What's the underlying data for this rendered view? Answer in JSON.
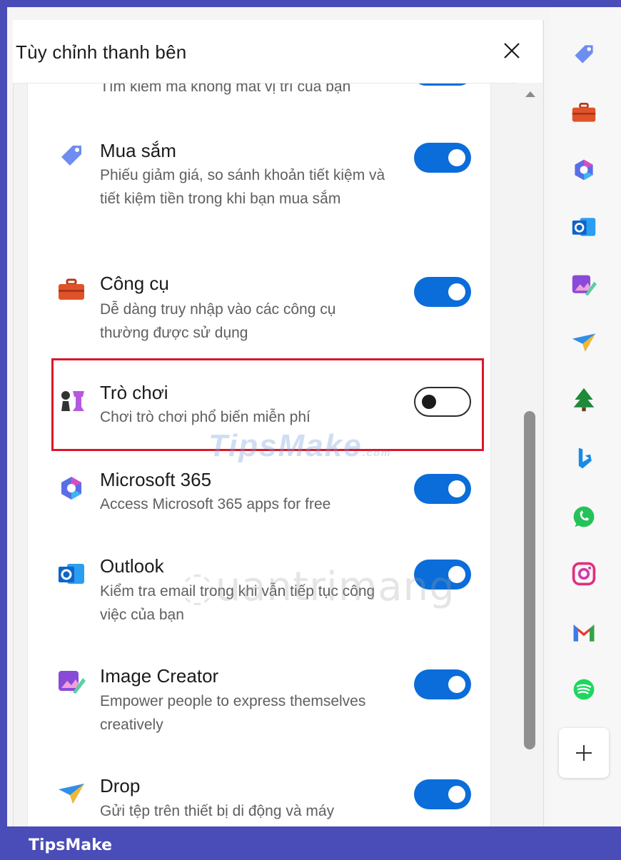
{
  "panel": {
    "title": "Tùy chỉnh thanh bên"
  },
  "partial_above": {
    "desc": "Tìm kiếm mà không mất vị trí của bạn",
    "enabled": true
  },
  "items": [
    {
      "title": "Mua sắm",
      "desc": "Phiếu giảm giá, so sánh khoản tiết kiệm và tiết kiệm tiền trong khi bạn mua sắm",
      "enabled": true,
      "icon": "shopping-tag-icon"
    },
    {
      "title": "Công cụ",
      "desc": "Dễ dàng truy nhập vào các công cụ thường được sử dụng",
      "enabled": true,
      "icon": "toolbox-icon"
    },
    {
      "title": "Trò chơi",
      "desc": "Chơi trò chơi phổ biến miễn phí",
      "enabled": false,
      "icon": "chess-pieces-icon"
    },
    {
      "title": "Microsoft 365",
      "desc": "Access Microsoft 365 apps for free",
      "enabled": true,
      "icon": "microsoft365-icon"
    },
    {
      "title": "Outlook",
      "desc": "Kiểm tra email trong khi vẫn tiếp tục công việc của bạn",
      "enabled": true,
      "icon": "outlook-icon"
    },
    {
      "title": "Image Creator",
      "desc": "Empower people to express themselves creatively",
      "enabled": true,
      "icon": "image-creator-icon"
    },
    {
      "title": "Drop",
      "desc": "Gửi tệp trên thiết bị di động và máy",
      "enabled": true,
      "icon": "drop-icon"
    }
  ],
  "rail": [
    "shopping-tag-icon",
    "toolbox-icon",
    "microsoft365-icon",
    "outlook-icon",
    "image-creator-icon",
    "drop-icon",
    "tree-icon",
    "bing-icon",
    "whatsapp-icon",
    "instagram-icon",
    "gmail-icon",
    "spotify-icon"
  ],
  "watermarks": {
    "tipsmake": "TipsMake",
    "tipsmake_suffix": ".com",
    "quantrimang": "uantrimang"
  },
  "footer": {
    "brand": "TipsMake"
  },
  "colors": {
    "accent": "#0a6dd9",
    "frame": "#4a4cb8",
    "highlight": "#d9182a"
  }
}
